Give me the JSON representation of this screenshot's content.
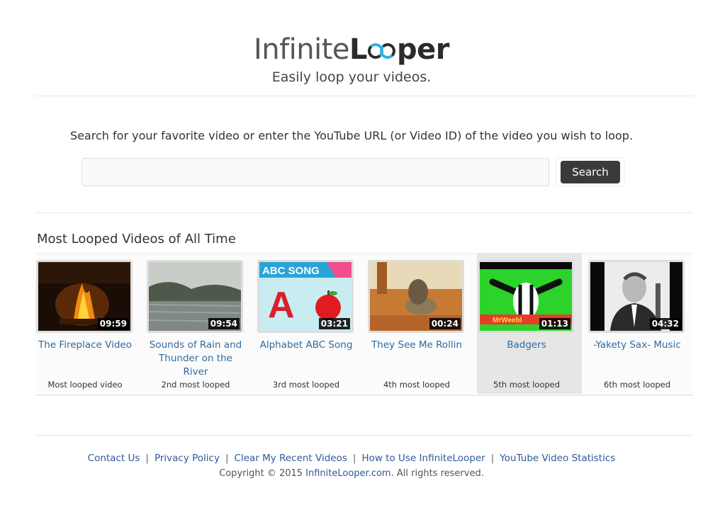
{
  "header": {
    "logo_part1": "Infinite",
    "logo_part2a": "L",
    "logo_part2b": "per",
    "tagline": "Easily loop your videos."
  },
  "search": {
    "instructions": "Search for your favorite video or enter the YouTube URL (or Video ID) of the video you wish to loop.",
    "input_value": "",
    "placeholder": "",
    "button_label": "Search"
  },
  "most_looped": {
    "title": "Most Looped Videos of All Time",
    "videos": [
      {
        "title": "The Fireplace Video",
        "duration": "09:59",
        "rank": "Most looped video",
        "thumb_icon": "fireplace-thumbnail"
      },
      {
        "title": "Sounds of Rain and Thunder on the River",
        "duration": "09:54",
        "rank": "2nd most looped",
        "thumb_icon": "rain-river-thumbnail"
      },
      {
        "title": "Alphabet ABC Song",
        "duration": "03:21",
        "rank": "3rd most looped",
        "thumb_icon": "abc-song-thumbnail",
        "thumb_text": "ABC SONG"
      },
      {
        "title": "They See Me Rollin",
        "duration": "00:24",
        "rank": "4th most looped",
        "thumb_icon": "turtle-cat-thumbnail"
      },
      {
        "title": "Badgers",
        "duration": "01:13",
        "rank": "5th most looped",
        "thumb_icon": "badger-thumbnail",
        "thumb_text": "MrWeebl",
        "active": true
      },
      {
        "title": "-Yakety Sax- Music",
        "duration": "04:32",
        "rank": "6th most looped",
        "thumb_icon": "saxophonist-thumbnail"
      }
    ]
  },
  "footer": {
    "links": [
      "Contact Us",
      "Privacy Policy",
      "Clear My Recent Videos",
      "How to Use InfiniteLooper",
      "YouTube Video Statistics"
    ],
    "separator": "|",
    "copyright_prefix": "Copyright © 2015 ",
    "copyright_link": "InfiniteLooper.com",
    "copyright_suffix": ". All rights reserved."
  },
  "colors": {
    "link": "#2f6aa0",
    "logo_accent": "#2bb3e6",
    "button_bg": "#3a3a3a"
  }
}
